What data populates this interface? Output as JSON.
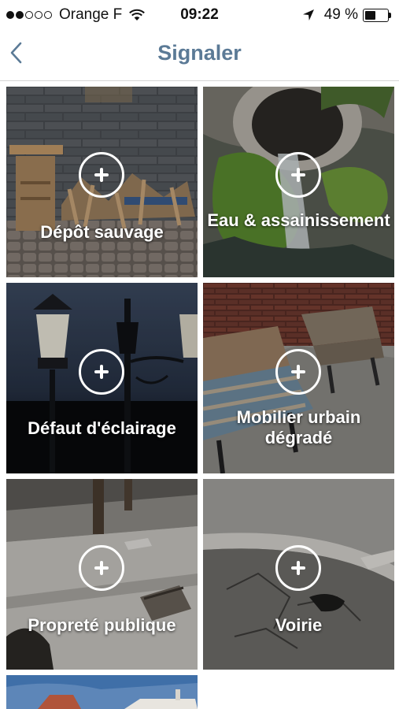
{
  "status_bar": {
    "carrier": "Orange F",
    "time": "09:22",
    "battery_percent": "49 %",
    "battery_level": 0.49,
    "signal_bars_filled": 2,
    "signal_bars_total": 5
  },
  "nav": {
    "title": "Signaler",
    "accent_color": "#5b7a96"
  },
  "categories": [
    {
      "label": "Dépôt sauvage",
      "icon": "plus-circle-icon"
    },
    {
      "label": "Eau & assainissement",
      "icon": "plus-circle-icon"
    },
    {
      "label": "Défaut d'éclairage",
      "icon": "plus-circle-icon"
    },
    {
      "label": "Mobilier urbain dégradé",
      "icon": "plus-circle-icon"
    },
    {
      "label": "Propreté publique",
      "icon": "plus-circle-icon"
    },
    {
      "label": "Voirie",
      "icon": "plus-circle-icon"
    }
  ]
}
